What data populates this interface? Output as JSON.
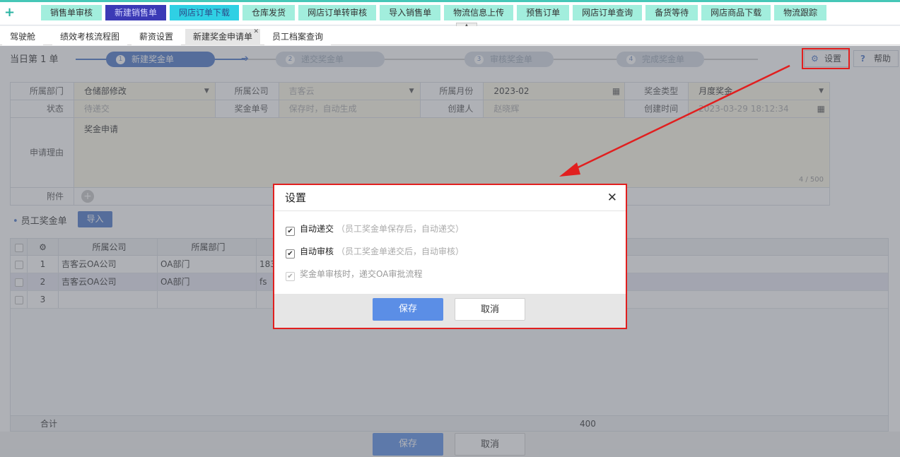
{
  "top_menu": [
    "销售单审核",
    "新建销售单",
    "网店订单下载",
    "仓库发货",
    "网店订单转审核",
    "导入销售单",
    "物流信息上传",
    "预售订单",
    "网店订单查询",
    "备货等待",
    "网店商品下载",
    "物流跟踪"
  ],
  "tabs": [
    "驾驶舱",
    "绩效考核流程图",
    "薪资设置",
    "新建奖金申请单",
    "员工档案查询"
  ],
  "page": {
    "counter": "当日第 1 单",
    "steps": [
      {
        "num": "1",
        "label": "新建奖金单"
      },
      {
        "num": "2",
        "label": "递交奖金单"
      },
      {
        "num": "3",
        "label": "审核奖金单"
      },
      {
        "num": "4",
        "label": "完成奖金单"
      }
    ],
    "settings_label": "设置",
    "help_label": "帮助"
  },
  "form": {
    "dept_label": "所属部门",
    "dept_value": "仓储部修改",
    "company_label": "所属公司",
    "company_value": "吉客云",
    "month_label": "所属月份",
    "month_value": "2023-02",
    "type_label": "奖金类型",
    "type_value": "月度奖金",
    "status_label": "状态",
    "status_value": "待递交",
    "bill_no_label": "奖金单号",
    "bill_no_value": "保存时，自动生成",
    "creator_label": "创建人",
    "creator_value": "赵晓辉",
    "ctime_label": "创建时间",
    "ctime_value": "2023-03-29 18:12:34",
    "reason_label": "申请理由",
    "reason_value": "奖金申请",
    "reason_count": "4 / 500",
    "attach_label": "附件"
  },
  "section": {
    "title": "员工奖金单",
    "import_label": "导入"
  },
  "grid": {
    "headers": [
      "所属公司",
      "所属部门"
    ],
    "rows": [
      {
        "no": "1",
        "company": "吉客云OA公司",
        "dept": "OA部门",
        "extra": "183"
      },
      {
        "no": "2",
        "company": "吉客云OA公司",
        "dept": "OA部门",
        "extra": "fs"
      },
      {
        "no": "3",
        "company": "",
        "dept": "",
        "extra": ""
      }
    ],
    "total_label": "合计",
    "total_value": "400"
  },
  "bottom": {
    "save_label": "保存",
    "cancel_label": "取消"
  },
  "dialog": {
    "title": "设置",
    "options": [
      {
        "label": "自动递交",
        "hint": "（员工奖金单保存后，自动递交）",
        "checked": true,
        "disabled": false
      },
      {
        "label": "自动审核",
        "hint": "（员工奖金单递交后，自动审核）",
        "checked": true,
        "disabled": false
      },
      {
        "label": "奖金单审核时，递交OA审批流程",
        "hint": "",
        "checked": true,
        "disabled": true
      }
    ],
    "save_label": "保存",
    "cancel_label": "取消"
  },
  "colors": {
    "accent": "#4a76c8",
    "menu_bg": "#a2eedd",
    "highlight": "#e11f1f",
    "form_bg": "#fcf8e6"
  }
}
